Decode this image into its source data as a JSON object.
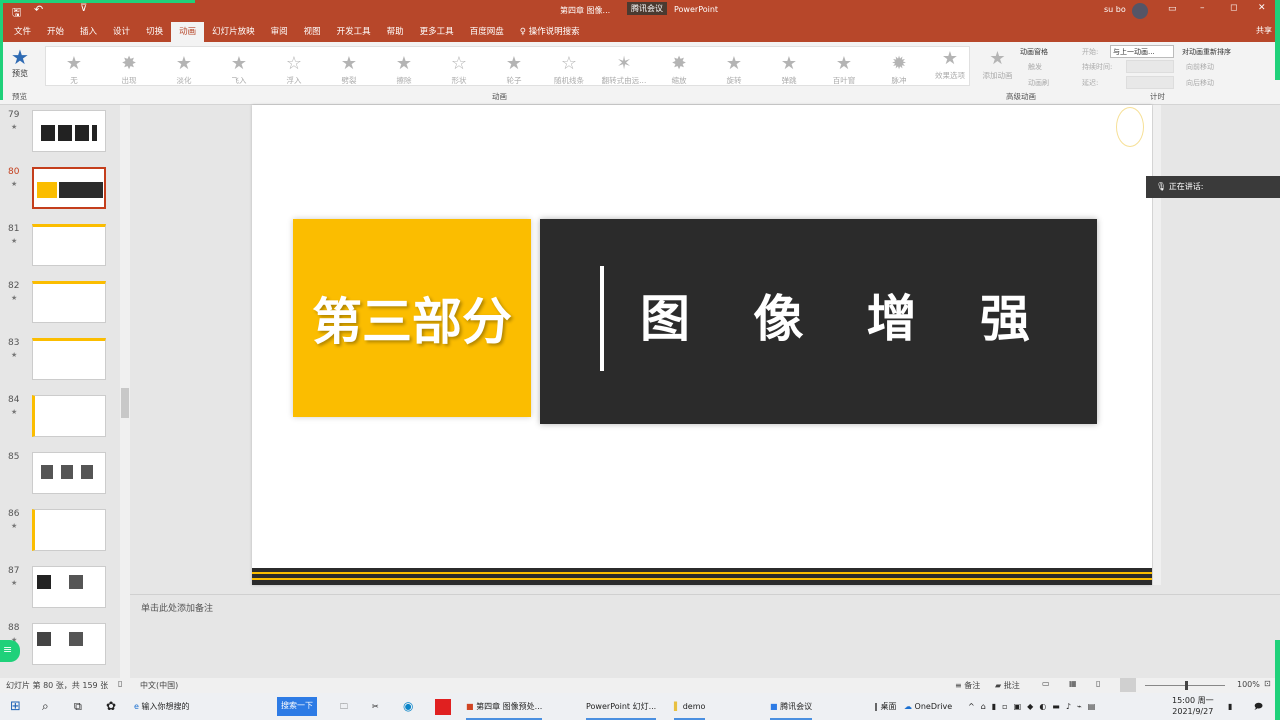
{
  "titlebar": {
    "doc_title": "第四章 图像...",
    "app": "PowerPoint",
    "meeting": "腾讯会议",
    "user": "su bo",
    "share": "共享"
  },
  "tabs": [
    "文件",
    "开始",
    "插入",
    "设计",
    "切换",
    "动画",
    "幻灯片放映",
    "审阅",
    "视图",
    "开发工具",
    "帮助",
    "更多工具",
    "百度网盘",
    "操作说明搜索"
  ],
  "active_tab": "动画",
  "ribbon": {
    "preview": "预览",
    "preview_group": "预览",
    "animations": [
      "无",
      "出现",
      "淡化",
      "飞入",
      "浮入",
      "劈裂",
      "擦除",
      "形状",
      "轮子",
      "随机线条",
      "翻转式由远...",
      "缩放",
      "旋转",
      "弹跳",
      "百叶窗",
      "脉冲"
    ],
    "effect_options": "效果选项",
    "add_animation": "添加动画",
    "anim_pane": "动画窗格",
    "trigger": "触发",
    "anim_painter": "动画刷",
    "group_animation": "动画",
    "group_advanced": "高级动画",
    "start_label": "开始:",
    "start_value": "与上一动画...",
    "duration": "持续时间:",
    "delay": "延迟:",
    "reorder": "对动画重新排序",
    "move_earlier": "向前移动",
    "move_later": "向后移动",
    "group_timing": "计时"
  },
  "thumbnails": [
    {
      "num": "79"
    },
    {
      "num": "80",
      "selected": true
    },
    {
      "num": "81"
    },
    {
      "num": "82"
    },
    {
      "num": "83"
    },
    {
      "num": "84"
    },
    {
      "num": "85"
    },
    {
      "num": "86"
    },
    {
      "num": "87"
    },
    {
      "num": "88"
    }
  ],
  "slide": {
    "left_title": "第三部分",
    "right_chars": [
      "图",
      "像",
      "增",
      "强"
    ],
    "yellow": "#fbbd00",
    "dark": "#2b2b2b"
  },
  "speaking": "正在讲话:",
  "notes_placeholder": "单击此处添加备注",
  "status": {
    "slide_info": "幻灯片 第 80 张，共 159 张",
    "language": "中文(中国)",
    "notes": "备注",
    "comments": "批注",
    "zoom": "100%"
  },
  "taskbar": {
    "search": "输入你想搜的",
    "search_btn": "搜索一下",
    "ppt_doc": "第四章 图像预处...",
    "ppt_show": "PowerPoint 幻灯...",
    "demo": "demo",
    "meeting": "腾讯会议",
    "desktop": "桌面",
    "onedrive": "OneDrive",
    "time": "15:00 周一",
    "date": "2021/9/27"
  }
}
